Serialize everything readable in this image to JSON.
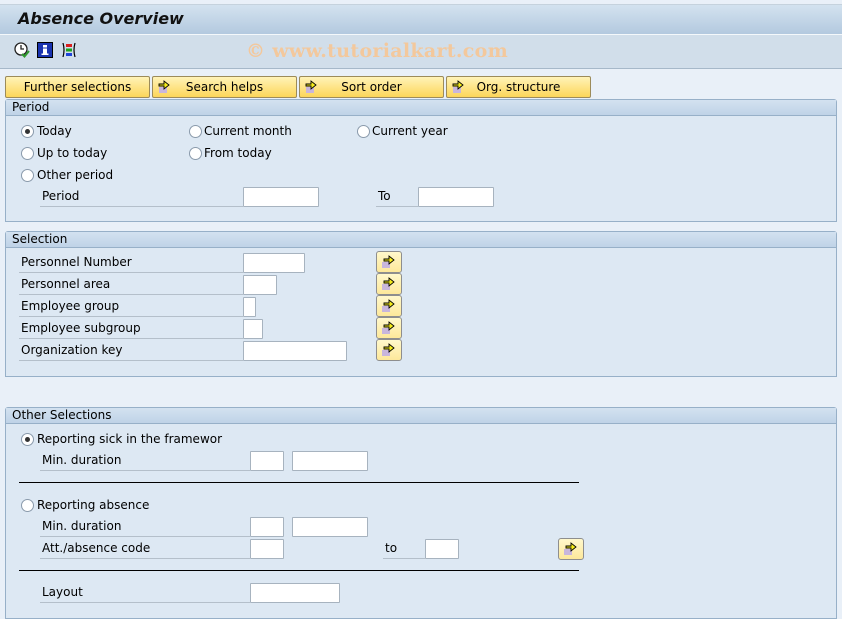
{
  "window": {
    "title": "Absence Overview",
    "watermark": "© www.tutorialkart.com"
  },
  "toolbar": {
    "icons": [
      {
        "name": "execute-clock-icon",
        "label": "Execute"
      },
      {
        "name": "info-icon",
        "label": "Information"
      },
      {
        "name": "layout-selection-icon",
        "label": "Selection options"
      }
    ]
  },
  "app_buttons": [
    {
      "label": "Further selections",
      "has_arrow": false
    },
    {
      "label": "Search helps",
      "has_arrow": true
    },
    {
      "label": "Sort order",
      "has_arrow": true
    },
    {
      "label": "Org. structure",
      "has_arrow": true
    }
  ],
  "period": {
    "header": "Period",
    "radios": {
      "today": {
        "label": "Today",
        "selected": true
      },
      "current_month": {
        "label": "Current month",
        "selected": false
      },
      "current_year": {
        "label": "Current year",
        "selected": false
      },
      "up_to_today": {
        "label": "Up to today",
        "selected": false
      },
      "from_today": {
        "label": "From today",
        "selected": false
      },
      "other_period": {
        "label": "Other period",
        "selected": false
      }
    },
    "period_label": "Period",
    "period_from_value": "",
    "to_label": "To",
    "period_to_value": ""
  },
  "selection": {
    "header": "Selection",
    "fields": [
      {
        "label": "Personnel Number",
        "value": ""
      },
      {
        "label": "Personnel area",
        "value": ""
      },
      {
        "label": "Employee group",
        "value": ""
      },
      {
        "label": "Employee subgroup",
        "value": ""
      },
      {
        "label": "Organization key",
        "value": ""
      }
    ]
  },
  "other_selections": {
    "header": "Other Selections",
    "reporting_sick": {
      "label": "Reporting sick in the framewor",
      "selected": true
    },
    "sick_min_duration_label": "Min. duration",
    "sick_min_duration_value": "",
    "sick_min_duration_unit": "",
    "reporting_absence": {
      "label": "Reporting absence",
      "selected": false
    },
    "abs_min_duration_label": "Min. duration",
    "abs_min_duration_value": "",
    "abs_min_duration_unit": "",
    "att_absence_code_label": "Att./absence code",
    "att_absence_code_from": "",
    "to_label": "to",
    "att_absence_code_to": "",
    "layout_label": "Layout",
    "layout_value": ""
  }
}
